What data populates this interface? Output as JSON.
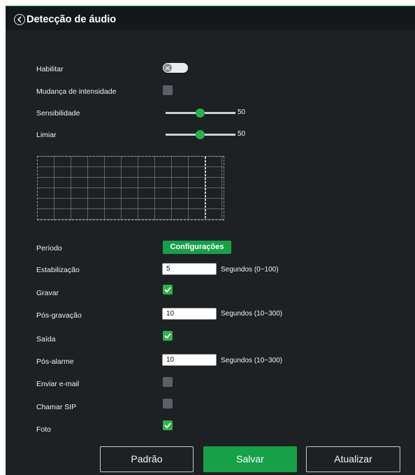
{
  "header": {
    "title": "Detecção de áudio"
  },
  "form": {
    "habilitar": {
      "label": "Habilitar",
      "enabled": false
    },
    "mudanca": {
      "label": "Mudança de intensidade",
      "checked": false
    },
    "sensibilidade": {
      "label": "Sensibilidade",
      "value": "50"
    },
    "limiar": {
      "label": "Limiar",
      "value": "50"
    },
    "periodo": {
      "label": "Período",
      "button_label": "Configurações"
    },
    "estabilizacao": {
      "label": "Estabilização",
      "value": "5",
      "unit": "Segundos (0~100)"
    },
    "gravar": {
      "label": "Gravar",
      "checked": true
    },
    "pos_gravacao": {
      "label": "Pós-gravação",
      "value": "10",
      "unit": "Segundos (10~300)"
    },
    "saida": {
      "label": "Saída",
      "checked": true
    },
    "pos_alarme": {
      "label": "Pós-alarme",
      "value": "10",
      "unit": "Segundos (10~300)"
    },
    "enviar_email": {
      "label": "Enviar e-mail",
      "checked": false
    },
    "chamar_sip": {
      "label": "Chamar SIP",
      "checked": false
    },
    "foto": {
      "label": "Foto",
      "checked": true
    }
  },
  "buttons": {
    "padrao": "Padrão",
    "salvar": "Salvar",
    "atualizar": "Atualizar"
  },
  "colors": {
    "accent": "#16a148",
    "background": "#1e2124",
    "header": "#15181a"
  }
}
